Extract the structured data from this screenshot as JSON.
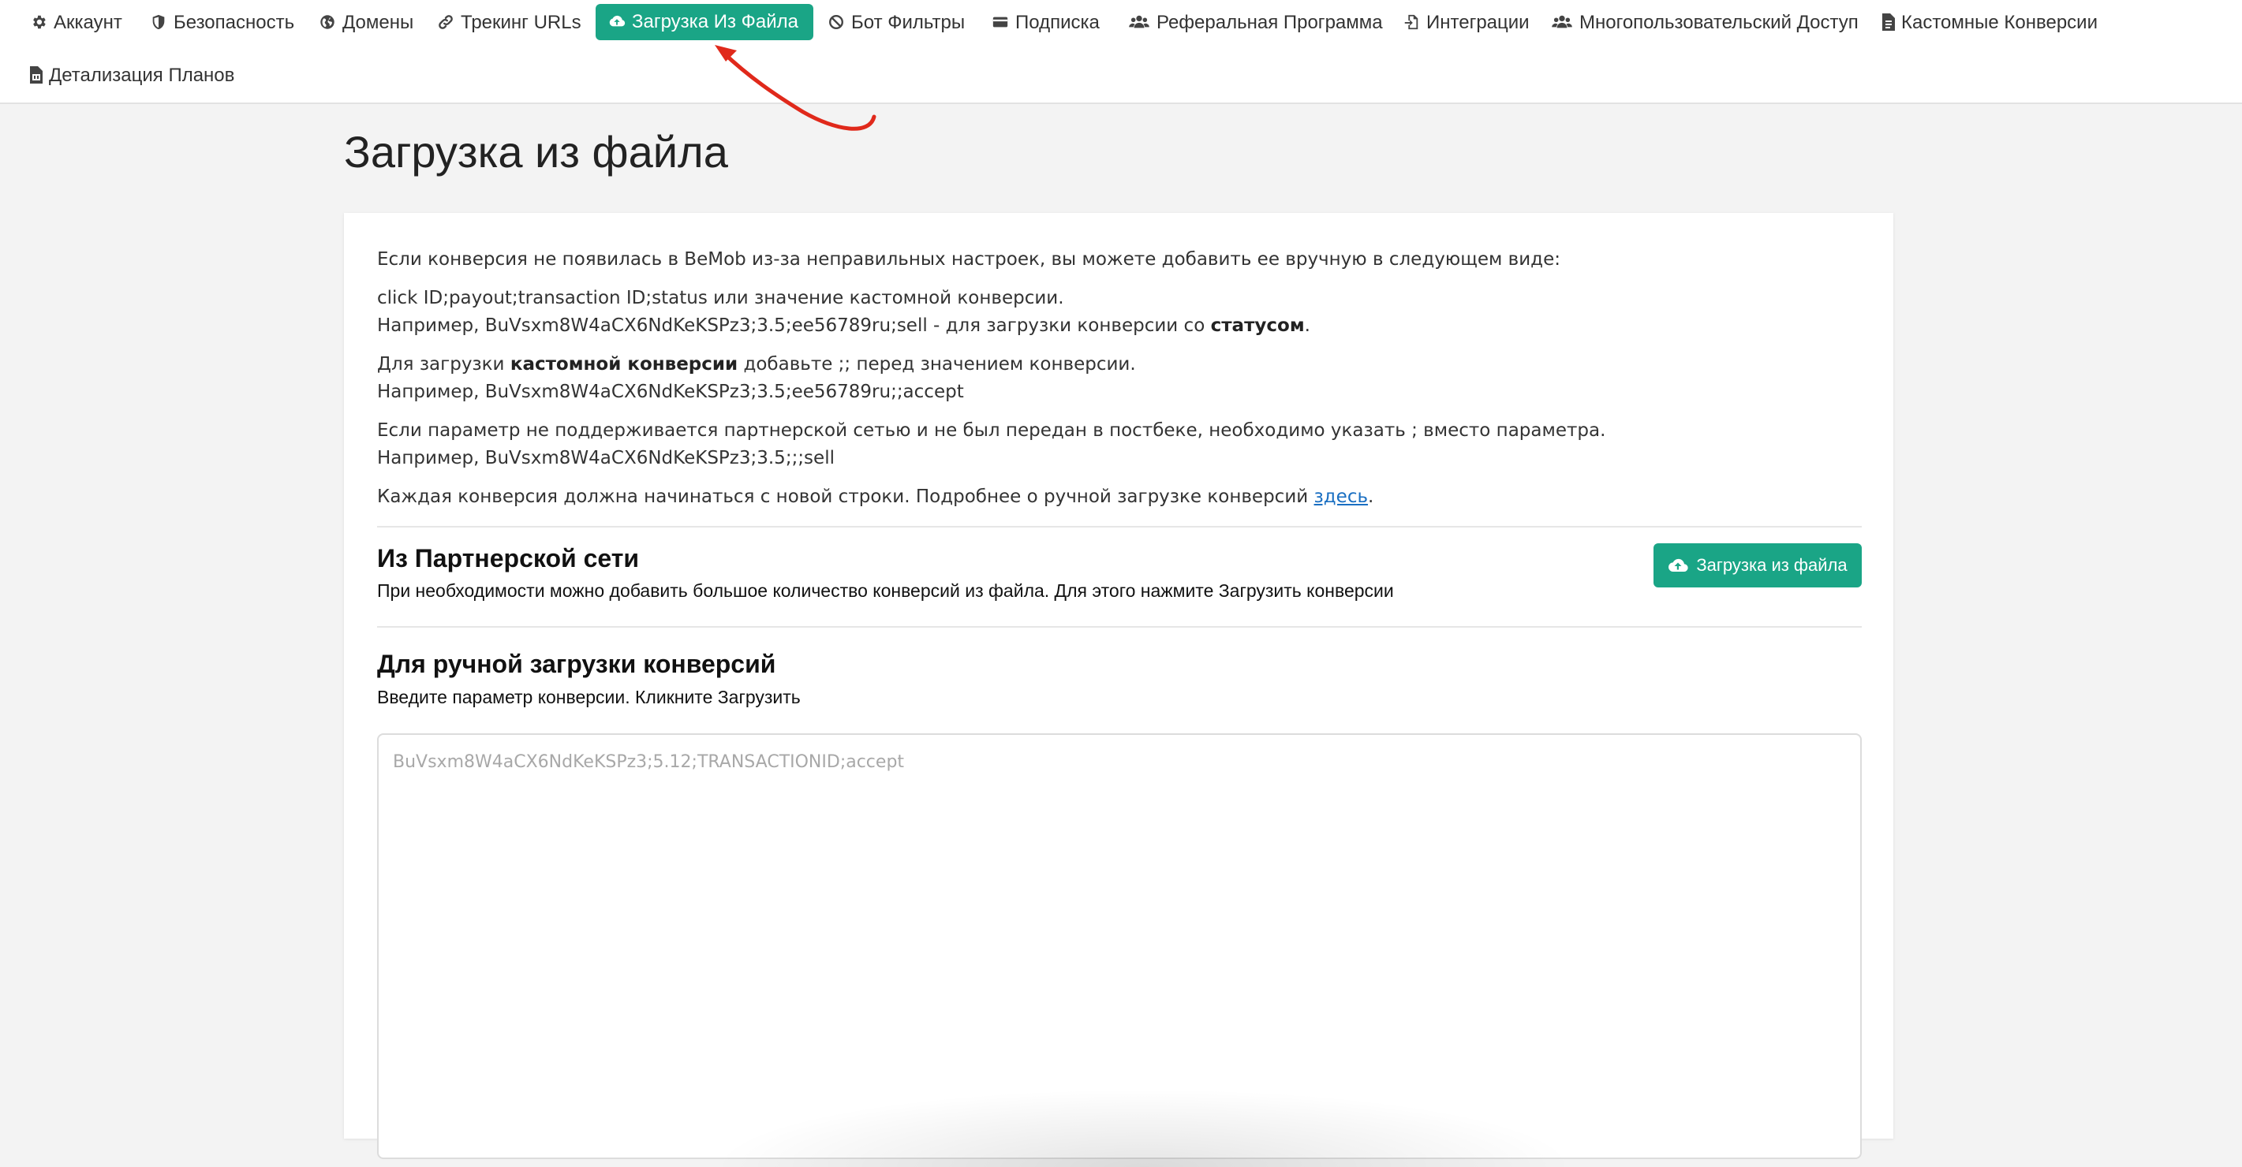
{
  "nav": {
    "tabs": [
      {
        "label": "Аккаунт",
        "icon": "gear-icon"
      },
      {
        "label": "Безопасность",
        "icon": "shield-icon"
      },
      {
        "label": "Домены",
        "icon": "globe-icon"
      },
      {
        "label": "Трекинг URLs",
        "icon": "link-icon"
      },
      {
        "label": "Загрузка Из Файла",
        "icon": "cloud-upload-icon",
        "active": true
      },
      {
        "label": "Бот Фильтры",
        "icon": "ban-icon"
      },
      {
        "label": "Подписка",
        "icon": "credit-card-icon"
      },
      {
        "label": "Реферальная Программа",
        "icon": "users-icon"
      },
      {
        "label": "Интеграции",
        "icon": "file-import-icon"
      },
      {
        "label": "Многопользовательский Доступ",
        "icon": "users-icon"
      },
      {
        "label": "Кастомные Конверсии",
        "icon": "file-icon"
      },
      {
        "label": "Детализация Планов",
        "icon": "file-pdf-icon"
      }
    ]
  },
  "page": {
    "title": "Загрузка из файла"
  },
  "intro": {
    "p1": "Если конверсия не появилась в BeMob из-за неправильных настроек, вы можете добавить ее вручную в следующем виде:",
    "p2_line1": "click ID;payout;transaction ID;status или значение кастомной конверсии.",
    "p2_line2_prefix": "Например, BuVsxm8W4aCX6NdKeKSPz3;3.5;ee56789ru;sell - для загрузки конверсии со ",
    "p2_line2_bold": "статусом",
    "p2_line2_suffix": ".",
    "p3_prefix": "Для загрузки ",
    "p3_bold": "кастомной конверсии",
    "p3_suffix": " добавьте ;; перед значением конверсии.",
    "p3_line2": "Например, BuVsxm8W4aCX6NdKeKSPz3;3.5;ee56789ru;;accept",
    "p4_line1": "Если параметр не поддерживается партнерской сетью и не был передан в постбеке, необходимо указать ; вместо параметра.",
    "p4_line2": "Например, BuVsxm8W4aCX6NdKeKSPz3;3.5;;;sell",
    "p5_prefix": "Каждая конверсия должна начинаться с новой строки. Подробнее о ручной загрузке конверсий ",
    "p5_link": "здесь",
    "p5_suffix": "."
  },
  "partner": {
    "title": "Из Партнерской сети",
    "desc": "При необходимости можно добавить большое количество конверсий из файла. Для этого нажмите Загрузить конверсии",
    "button_label": "Загрузка из файла"
  },
  "manual": {
    "title": "Для ручной загрузки конверсий",
    "desc": "Введите параметр конверсии. Кликните Загрузить",
    "placeholder": "BuVsxm8W4aCX6NdKeKSPz3;5.12;TRANSACTIONID;accept"
  },
  "colors": {
    "accent": "#1aa586",
    "annotation_arrow": "#e0291b",
    "link": "#1a6fc2"
  }
}
